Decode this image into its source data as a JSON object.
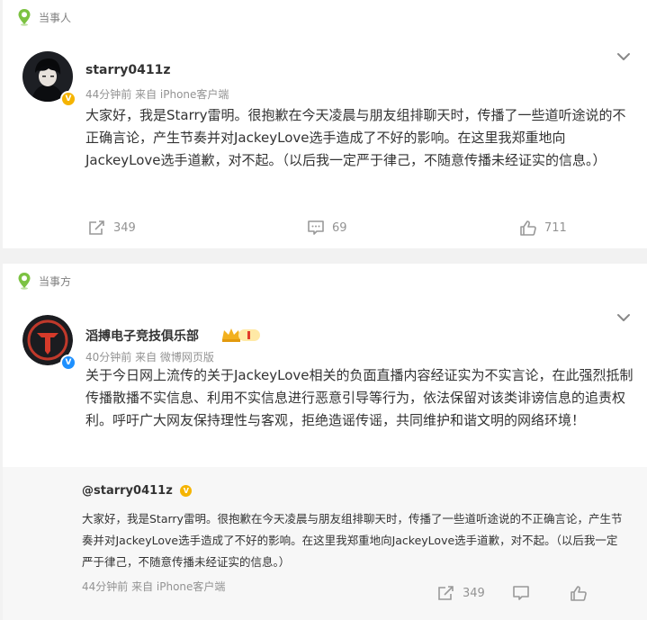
{
  "posts": [
    {
      "tag": "当事人",
      "username": "starry0411z",
      "meta": "44分钟前  来自 iPhone客户端",
      "text": "大家好，我是Starry雷明。很抱歉在今天凌晨与朋友组排聊天时，传播了一些道听途说的不正确言论，产生节奏并对JackeyLove选手造成了不好的影响。在这里我郑重地向JackeyLove选手道歉，对不起。（以后我一定严于律己，不随意传播未经证实的信息。）",
      "repost_count": "349",
      "comment_count": "69",
      "like_count": "711",
      "verified_color": "#f5b400"
    },
    {
      "tag": "当事方",
      "username": "滔搏电子竞技俱乐部",
      "meta": "40分钟前  来自 微博网页版",
      "text": "关于今日网上流传的关于JackeyLove相关的负面直播内容经证实为不实言论，在此强烈抵制传播散播不实信息、利用不实信息进行恶意引导等行为，依法保留对该类诽谤信息的追责权利。呼吁广大网友保持理性与客观，拒绝造谣传谣，共同维护和谐文明的网络环境！",
      "verified_color": "#1e90ff",
      "repost": {
        "username": "@starry0411z",
        "text": "大家好，我是Starry雷明。很抱歉在今天凌晨与朋友组排聊天时，传播了一些道听途说的不正确言论，产生节奏并对JackeyLove选手造成了不好的影响。在这里我郑重地向JackeyLove选手道歉，对不起。（以后我一定严于律己，不随意传播未经证实的信息。）",
        "meta": "44分钟前 来自 iPhone客户端",
        "repost_count": "349"
      }
    }
  ],
  "colors": {
    "tag_icon": "#7cc242",
    "text_gray": "#939393",
    "background": "#f2f2f2"
  },
  "icons": [
    "location-pin-icon",
    "chevron-down-icon",
    "repost-icon",
    "comment-icon",
    "like-icon",
    "verified-badge-icon",
    "member-crown-icon"
  ]
}
